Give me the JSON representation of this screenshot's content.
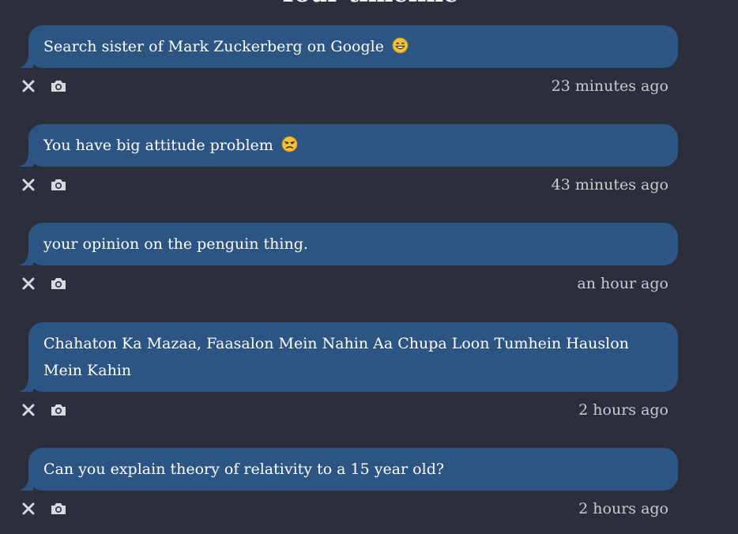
{
  "timeline": {
    "title": "Your timeline",
    "accent_color": "#2d5584",
    "background_color": "#2a2f3b",
    "items": [
      {
        "text": "Search sister of Mark Zuckerberg on Google",
        "emoji": "grinning-sweat-emoji",
        "time": "23 minutes ago"
      },
      {
        "text": "You have big attitude problem",
        "emoji": "unamused-face-emoji",
        "time": "43 minutes ago"
      },
      {
        "text": "your opinion on the penguin thing.",
        "emoji": "",
        "time": "an hour ago"
      },
      {
        "text": "Chahaton Ka Mazaa, Faasalon Mein Nahin Aa Chupa Loon Tumhein Hauslon Mein Kahin",
        "emoji": "",
        "time": "2 hours ago"
      },
      {
        "text": "Can you explain theory of relativity to a 15 year old?",
        "emoji": "",
        "time": "2 hours ago"
      }
    ],
    "icons": {
      "delete": "close-icon",
      "screenshot": "camera-icon"
    }
  }
}
